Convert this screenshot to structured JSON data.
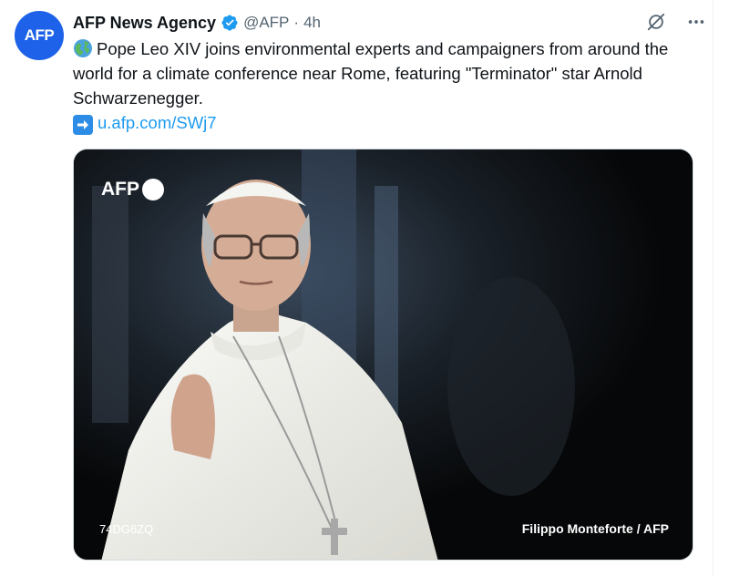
{
  "author": {
    "avatar_text": "AFP",
    "display_name": "AFP News Agency",
    "handle": "@AFP",
    "separator": "·",
    "time": "4h",
    "verified_icon": "verified-badge-icon"
  },
  "tweet": {
    "line1": "Pope Leo XIV joins environmental experts and campaigners from around the world for a climate conference near Rome, featuring \"Terminator\" star Arnold Schwarzenegger.",
    "link": "u.afp.com/SWj7",
    "globe_icon": "globe-icon",
    "arrow_icon": "right-arrow-icon"
  },
  "media": {
    "logo_text": "AFP",
    "photo_id": "74DG6ZQ",
    "credit": "Filippo Monteforte / AFP"
  },
  "actions": {
    "grok_icon": "grok-icon",
    "more_icon": "more-icon"
  },
  "colors": {
    "avatar": "#1d62e8",
    "link": "#1d9bf0",
    "verified": "#1d9bf0",
    "secondary_text": "#536471"
  }
}
